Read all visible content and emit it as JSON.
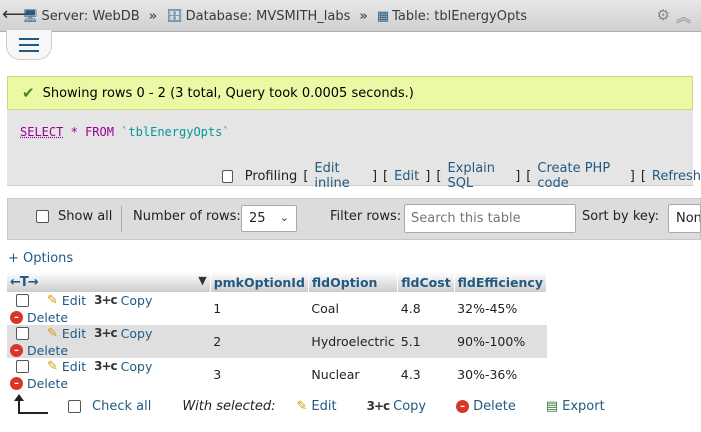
{
  "breadcrumb": {
    "server": "Server: WebDB",
    "database": "Database: MVSMITH_labs",
    "table": "Table: tblEnergyOpts",
    "separator": "»"
  },
  "message": "Showing rows 0 - 2 (3 total, Query took 0.0005 seconds.)",
  "sql": {
    "select": "SELECT",
    "star": "*",
    "from": "FROM",
    "table": "`tblEnergyOpts`"
  },
  "query_links": {
    "profiling": "Profiling",
    "edit_inline": "Edit inline",
    "edit": "Edit",
    "explain": "Explain SQL",
    "create_php": "Create PHP code",
    "refresh": "Refresh"
  },
  "nav": {
    "show_all": "Show all",
    "num_rows_label": "Number of rows:",
    "num_rows_value": "25",
    "filter_label": "Filter rows:",
    "filter_placeholder": "Search this table",
    "sort_label": "Sort by key:",
    "sort_value": "None"
  },
  "options_link": "+ Options",
  "table": {
    "header_arrows": "←T→",
    "columns": [
      "pmkOptionId",
      "fldOption",
      "fldCost",
      "fldEfficiency"
    ],
    "row_actions": {
      "edit": "Edit",
      "copy": "Copy",
      "delete": "Delete"
    },
    "rows": [
      [
        "1",
        "Coal",
        "4.8",
        "32%-45%"
      ],
      [
        "2",
        "Hydroelectric",
        "5.1",
        "90%-100%"
      ],
      [
        "3",
        "Nuclear",
        "4.3",
        "30%-36%"
      ]
    ]
  },
  "bulk": {
    "check_all": "Check all",
    "with_selected": "With selected:",
    "edit": "Edit",
    "copy": "Copy",
    "delete": "Delete",
    "export": "Export"
  }
}
